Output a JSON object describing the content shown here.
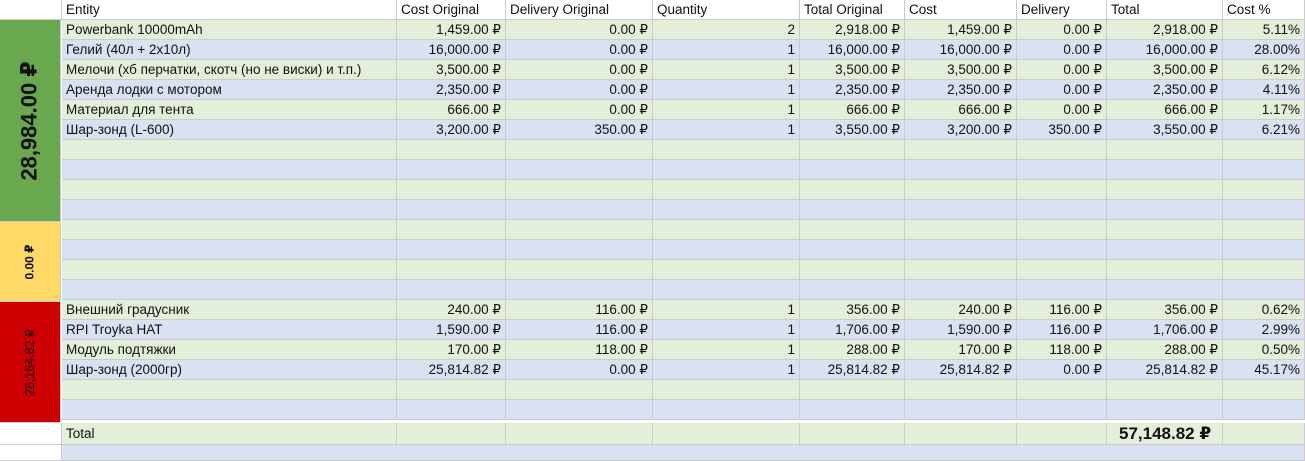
{
  "headers": [
    "Entity",
    "Cost Original",
    "Delivery Original",
    "Quantity",
    "Total Original",
    "Cost",
    "Delivery",
    "Total",
    "Cost %"
  ],
  "groups": [
    {
      "label": "28,984.00 ₽",
      "color": "#6aa84f"
    },
    {
      "label": "0.00 ₽",
      "color": "#ffd966"
    },
    {
      "label": "28,164.82 ₽",
      "color": "#cc0000"
    }
  ],
  "rows": [
    {
      "entity": "Powerbank 10000mAh",
      "cost_original": "1,459.00 ₽",
      "delivery_original": "0.00 ₽",
      "quantity": "2",
      "total_original": "2,918.00 ₽",
      "cost": "1,459.00 ₽",
      "delivery": "0.00 ₽",
      "total": "2,918.00 ₽",
      "cost_pct": "5.11%"
    },
    {
      "entity": "Гелий (40л + 2х10л)",
      "cost_original": "16,000.00 ₽",
      "delivery_original": "0.00 ₽",
      "quantity": "1",
      "total_original": "16,000.00 ₽",
      "cost": "16,000.00 ₽",
      "delivery": "0.00 ₽",
      "total": "16,000.00 ₽",
      "cost_pct": "28.00%"
    },
    {
      "entity": "Мелочи (хб перчатки, скотч (но не виски) и т.п.)",
      "cost_original": "3,500.00 ₽",
      "delivery_original": "0.00 ₽",
      "quantity": "1",
      "total_original": "3,500.00 ₽",
      "cost": "3,500.00 ₽",
      "delivery": "0.00 ₽",
      "total": "3,500.00 ₽",
      "cost_pct": "6.12%"
    },
    {
      "entity": "Аренда лодки с мотором",
      "cost_original": "2,350.00 ₽",
      "delivery_original": "0.00 ₽",
      "quantity": "1",
      "total_original": "2,350.00 ₽",
      "cost": "2,350.00 ₽",
      "delivery": "0.00 ₽",
      "total": "2,350.00 ₽",
      "cost_pct": "4.11%"
    },
    {
      "entity": "Материал для тента",
      "cost_original": "666.00 ₽",
      "delivery_original": "0.00 ₽",
      "quantity": "1",
      "total_original": "666.00 ₽",
      "cost": "666.00 ₽",
      "delivery": "0.00 ₽",
      "total": "666.00 ₽",
      "cost_pct": "1.17%"
    },
    {
      "entity": "Шар-зонд (L-600)",
      "cost_original": "3,200.00 ₽",
      "delivery_original": "350.00 ₽",
      "quantity": "1",
      "total_original": "3,550.00 ₽",
      "cost": "3,200.00 ₽",
      "delivery": "350.00 ₽",
      "total": "3,550.00 ₽",
      "cost_pct": "6.21%"
    },
    {
      "entity": "",
      "cost_original": "",
      "delivery_original": "",
      "quantity": "",
      "total_original": "",
      "cost": "",
      "delivery": "",
      "total": "",
      "cost_pct": ""
    },
    {
      "entity": "",
      "cost_original": "",
      "delivery_original": "",
      "quantity": "",
      "total_original": "",
      "cost": "",
      "delivery": "",
      "total": "",
      "cost_pct": ""
    },
    {
      "entity": "",
      "cost_original": "",
      "delivery_original": "",
      "quantity": "",
      "total_original": "",
      "cost": "",
      "delivery": "",
      "total": "",
      "cost_pct": ""
    },
    {
      "entity": "",
      "cost_original": "",
      "delivery_original": "",
      "quantity": "",
      "total_original": "",
      "cost": "",
      "delivery": "",
      "total": "",
      "cost_pct": ""
    },
    {
      "entity": "",
      "cost_original": "",
      "delivery_original": "",
      "quantity": "",
      "total_original": "",
      "cost": "",
      "delivery": "",
      "total": "",
      "cost_pct": ""
    },
    {
      "entity": "",
      "cost_original": "",
      "delivery_original": "",
      "quantity": "",
      "total_original": "",
      "cost": "",
      "delivery": "",
      "total": "",
      "cost_pct": ""
    },
    {
      "entity": "",
      "cost_original": "",
      "delivery_original": "",
      "quantity": "",
      "total_original": "",
      "cost": "",
      "delivery": "",
      "total": "",
      "cost_pct": ""
    },
    {
      "entity": "",
      "cost_original": "",
      "delivery_original": "",
      "quantity": "",
      "total_original": "",
      "cost": "",
      "delivery": "",
      "total": "",
      "cost_pct": ""
    },
    {
      "entity": "Внешний градусник",
      "cost_original": "240.00 ₽",
      "delivery_original": "116.00 ₽",
      "quantity": "1",
      "total_original": "356.00 ₽",
      "cost": "240.00 ₽",
      "delivery": "116.00 ₽",
      "total": "356.00 ₽",
      "cost_pct": "0.62%"
    },
    {
      "entity": "RPI Troyka HAT",
      "cost_original": "1,590.00 ₽",
      "delivery_original": "116.00 ₽",
      "quantity": "1",
      "total_original": "1,706.00 ₽",
      "cost": "1,590.00 ₽",
      "delivery": "116.00 ₽",
      "total": "1,706.00 ₽",
      "cost_pct": "2.99%"
    },
    {
      "entity": "Модуль подтяжки",
      "cost_original": "170.00 ₽",
      "delivery_original": "118.00 ₽",
      "quantity": "1",
      "total_original": "288.00 ₽",
      "cost": "170.00 ₽",
      "delivery": "118.00 ₽",
      "total": "288.00 ₽",
      "cost_pct": "0.50%"
    },
    {
      "entity": "Шар-зонд (2000гр)",
      "cost_original": "25,814.82 ₽",
      "delivery_original": "0.00 ₽",
      "quantity": "1",
      "total_original": "25,814.82 ₽",
      "cost": "25,814.82 ₽",
      "delivery": "0.00 ₽",
      "total": "25,814.82 ₽",
      "cost_pct": "45.17%"
    },
    {
      "entity": "",
      "cost_original": "",
      "delivery_original": "",
      "quantity": "",
      "total_original": "",
      "cost": "",
      "delivery": "",
      "total": "",
      "cost_pct": ""
    },
    {
      "entity": "",
      "cost_original": "",
      "delivery_original": "",
      "quantity": "",
      "total_original": "",
      "cost": "",
      "delivery": "",
      "total": "",
      "cost_pct": ""
    }
  ],
  "total_row": {
    "label": "Total",
    "amount": "57,148.82 ₽"
  }
}
